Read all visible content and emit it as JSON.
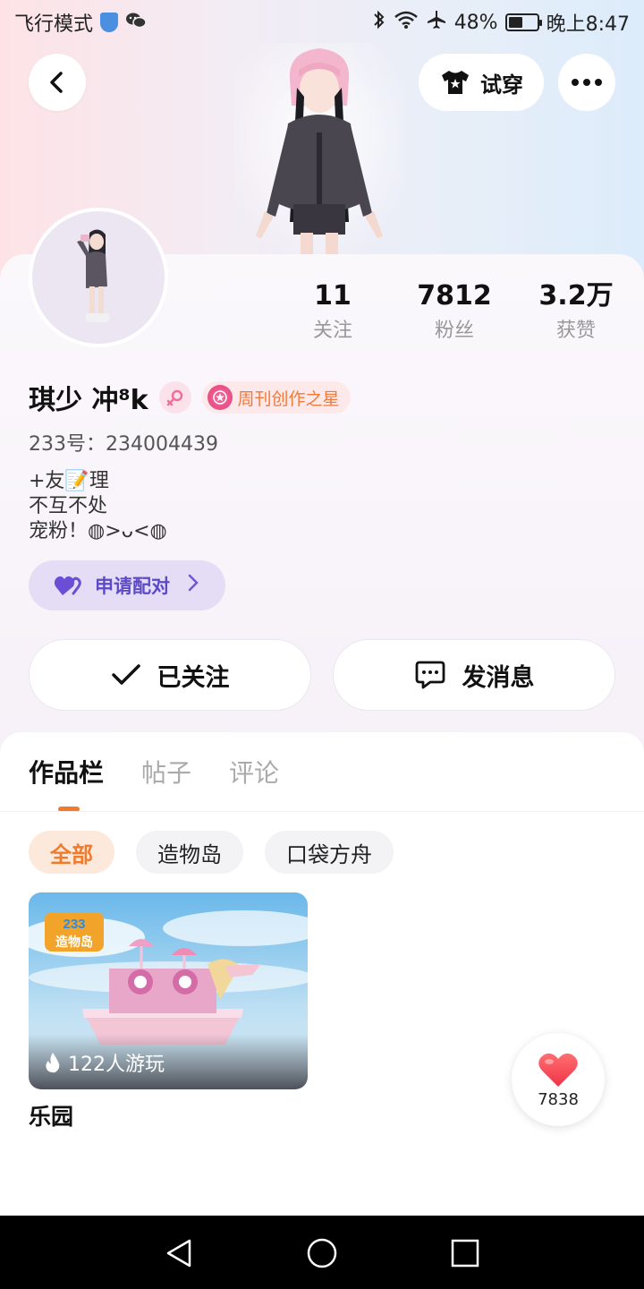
{
  "status_bar": {
    "airplane_mode_label": "飞行模式",
    "battery": "48%",
    "battery_level": 0.48,
    "time": "晚上8:47",
    "icons": [
      "shield-icon",
      "wechat-icon",
      "bluetooth-icon",
      "wifi-icon",
      "airplane-icon",
      "battery-icon"
    ]
  },
  "header": {
    "try_on_label": "试穿"
  },
  "profile": {
    "stats": [
      {
        "value": "11",
        "label": "关注"
      },
      {
        "value": "7812",
        "label": "粉丝"
      },
      {
        "value": "3.2万",
        "label": "获赞"
      }
    ],
    "username": "琪少 冲⁸k",
    "badge_label": "周刊创作之星",
    "uid": "233号：234004439",
    "bio_lines": [
      "+友📝理",
      "不互不处",
      "宠粉！◍>ᴗ<◍"
    ],
    "match_label": "申请配对",
    "follow_label": "已关注",
    "message_label": "发消息"
  },
  "tabs": [
    {
      "label": "作品栏",
      "active": true
    },
    {
      "label": "帖子",
      "active": false
    },
    {
      "label": "评论",
      "active": false
    }
  ],
  "filters": [
    {
      "label": "全部",
      "active": true
    },
    {
      "label": "造物岛",
      "active": false
    },
    {
      "label": "口袋方舟",
      "active": false
    }
  ],
  "works": [
    {
      "title": "乐园",
      "plays": "122人游玩",
      "logo": "233造物岛"
    }
  ],
  "like": {
    "count": "7838"
  },
  "colors": {
    "accent": "#f17b2c",
    "match_purple": "#5c4ac8",
    "badge_orange": "#ef7a3c"
  }
}
